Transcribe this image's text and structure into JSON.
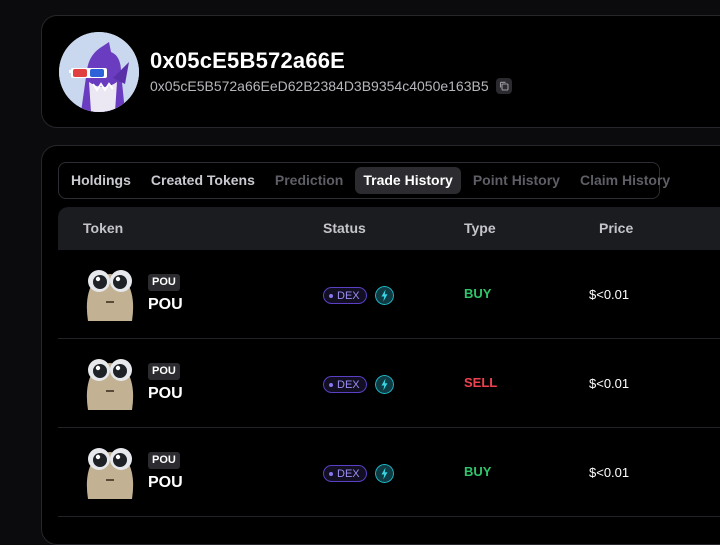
{
  "profile": {
    "name": "0x05cE5B572a66E",
    "address": "0x05cE5B572a66EeD62B2384D3B9354c4050e163B5"
  },
  "tabs": [
    {
      "label": "Holdings",
      "state": "enabled"
    },
    {
      "label": "Created Tokens",
      "state": "enabled"
    },
    {
      "label": "Prediction",
      "state": "disabled"
    },
    {
      "label": "Trade History",
      "state": "active"
    },
    {
      "label": "Point History",
      "state": "disabled"
    },
    {
      "label": "Claim History",
      "state": "disabled"
    }
  ],
  "table": {
    "headers": {
      "token": "Token",
      "status": "Status",
      "type": "Type",
      "price": "Price"
    },
    "rows": [
      {
        "symbol": "POU",
        "name": "POU",
        "status": "DEX",
        "type": "BUY",
        "price": "$<0.01"
      },
      {
        "symbol": "POU",
        "name": "POU",
        "status": "DEX",
        "type": "SELL",
        "price": "$<0.01"
      },
      {
        "symbol": "POU",
        "name": "POU",
        "status": "DEX",
        "type": "BUY",
        "price": "$<0.01"
      }
    ]
  },
  "colors": {
    "background": "#0b0b0d",
    "card": "#000000",
    "buy": "#2ec56a",
    "sell": "#f0414e",
    "dex_accent": "#5b3fc4",
    "chain_accent": "#1fb9c9"
  },
  "icons": {
    "copy": "copy-icon",
    "chain": "chain-logo-icon",
    "avatar": "shark-avatar"
  }
}
